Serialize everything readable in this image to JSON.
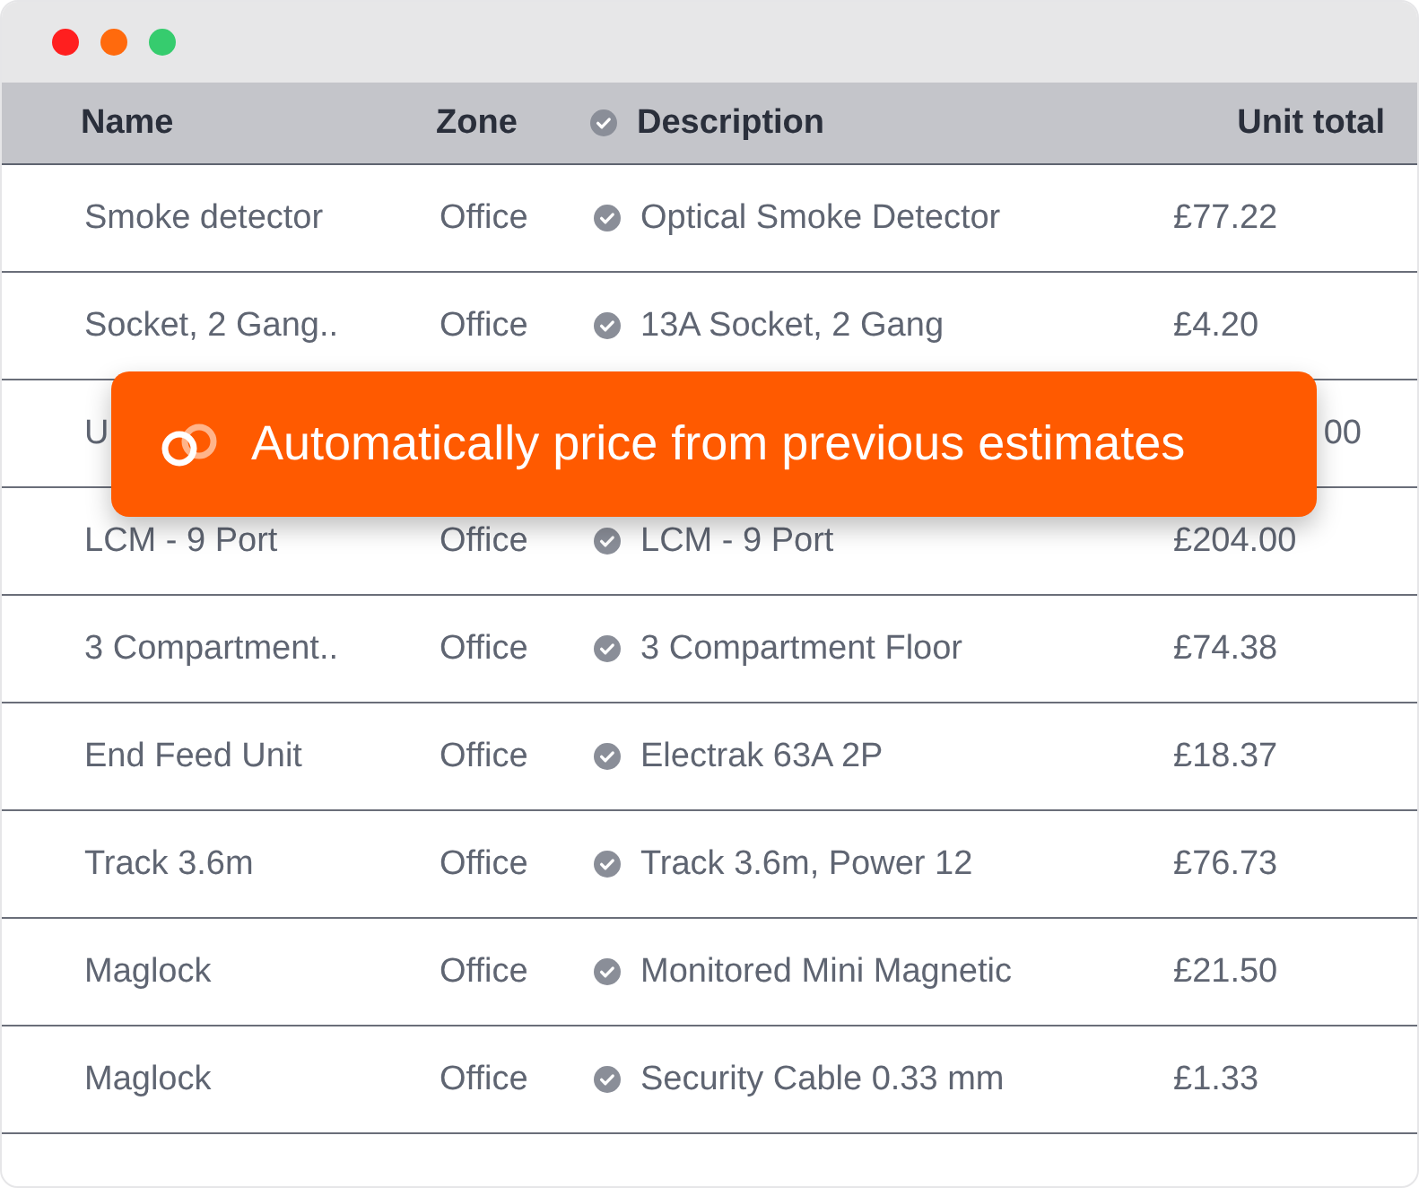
{
  "window": {
    "controls": [
      {
        "color": "#ff1f1f"
      },
      {
        "color": "#ff6a0d"
      },
      {
        "color": "#36cc6e"
      }
    ]
  },
  "table": {
    "columns": [
      "Name",
      "Zone",
      "Description",
      "Unit total"
    ],
    "rows": [
      {
        "kind": "full",
        "name": "Smoke detector",
        "zone": "Office",
        "description": "Optical Smoke Detector",
        "unit_total": "£77.22"
      },
      {
        "kind": "full",
        "name": "Socket, 2 Gang..",
        "zone": "Office",
        "description": "13A Socket, 2 Gang",
        "unit_total": "£4.20"
      },
      {
        "kind": "covered",
        "name": "U",
        "unit_total": "00"
      },
      {
        "kind": "full",
        "name": "LCM - 9 Port",
        "zone": "Office",
        "description": "LCM - 9 Port",
        "unit_total": "£204.00"
      },
      {
        "kind": "full",
        "name": "3 Compartment..",
        "zone": "Office",
        "description": "3 Compartment Floor",
        "unit_total": "£74.38"
      },
      {
        "kind": "full",
        "name": "End Feed Unit",
        "zone": "Office",
        "description": "Electrak 63A 2P",
        "unit_total": "£18.37"
      },
      {
        "kind": "full",
        "name": "Track 3.6m",
        "zone": "Office",
        "description": "Track 3.6m, Power 12",
        "unit_total": "£76.73"
      },
      {
        "kind": "full",
        "name": "Maglock",
        "zone": "Office",
        "description": "Monitored Mini Magnetic",
        "unit_total": "£21.50"
      },
      {
        "kind": "full",
        "name": "Maglock",
        "zone": "Office",
        "description": "Security Cable 0.33 mm",
        "unit_total": "£1.33"
      }
    ]
  },
  "toast": {
    "text": "Automatically price from previous estimates"
  }
}
